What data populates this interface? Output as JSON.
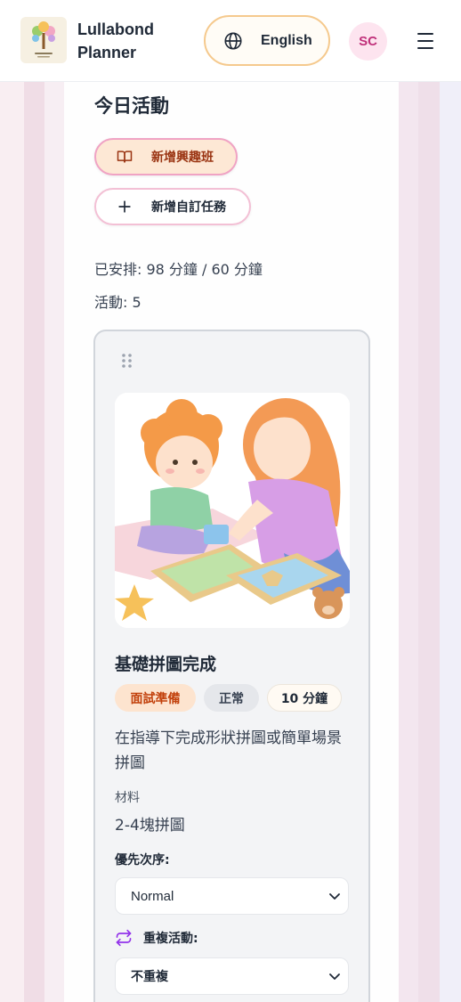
{
  "header": {
    "brand_line1": "Lullabond",
    "brand_line2": "Planner",
    "logo_caption": "Lullabond Planner",
    "language_label": "English",
    "avatar_initials": "SC"
  },
  "section": {
    "title": "今日活動",
    "add_interest_label": "新增興趣班",
    "add_custom_label": "新增自訂任務",
    "scheduled_summary": "已安排: 98 分鐘 / 60 分鐘",
    "activity_count": "活動: 5"
  },
  "activity": {
    "title": "基礎拼圖完成",
    "category_tag": "面試準備",
    "priority_tag": "正常",
    "duration_tag": "10 分鐘",
    "description": "在指導下完成形狀拼圖或簡單場景拼圖",
    "materials_label": "材料",
    "materials_value": "2-4塊拼圖",
    "priority_label": "優先次序:",
    "priority_value": "Normal",
    "repeat_label": "重複活動:",
    "repeat_value": "不重複"
  },
  "colors": {
    "accent_pink": "#f0a3c4",
    "accent_orange": "#f5c98d",
    "category_text": "#c2410c",
    "avatar_text": "#c0307a"
  },
  "icons": {
    "logo": "tree-logo-icon",
    "language": "globe-icon",
    "menu": "hamburger-menu-icon",
    "interest": "book-icon",
    "custom": "plus-icon",
    "drag": "drag-handle-icon",
    "repeat": "repeat-icon",
    "dropdown": "chevron-down-icon"
  }
}
